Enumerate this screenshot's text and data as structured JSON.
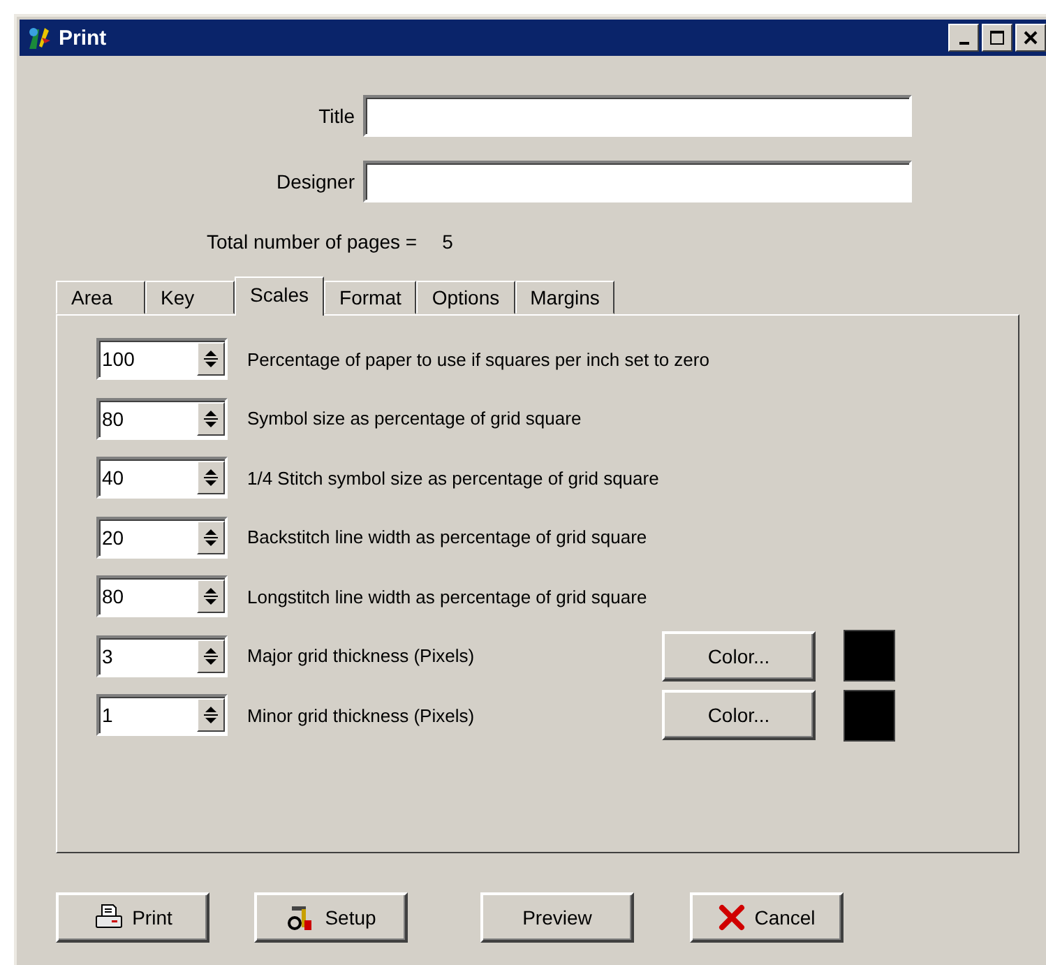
{
  "window": {
    "title": "Print"
  },
  "fields": [
    {
      "label": "Title"
    },
    {
      "label": "Designer"
    }
  ],
  "pages": {
    "label": "Total number of pages =",
    "value": "5"
  },
  "tabs": [
    {
      "label": "Area",
      "selected": false
    },
    {
      "label": "Key",
      "selected": false
    },
    {
      "label": "Scales",
      "selected": true
    },
    {
      "label": "Format",
      "selected": false
    },
    {
      "label": "Options",
      "selected": false
    },
    {
      "label": "Margins",
      "selected": false
    }
  ],
  "rows": [
    {
      "kind": "spin",
      "value": "100",
      "label": "Percentage of paper to use if squares per inch set to zero"
    },
    {
      "kind": "spin",
      "value": "80",
      "label": "Symbol size as percentage of grid square"
    },
    {
      "kind": "spin",
      "value": "40",
      "label": "1/4 Stitch symbol size as percentage of grid square"
    },
    {
      "kind": "spin",
      "value": "20",
      "label": "Backstitch line width as percentage of grid square"
    },
    {
      "kind": "spin",
      "value": "80",
      "label": "Longstitch line width as percentage of grid square"
    },
    {
      "kind": "color",
      "value": "3",
      "label": "Major grid thickness (Pixels)",
      "button": "Color...",
      "color": "#000000"
    },
    {
      "kind": "color",
      "value": "1",
      "label": "Minor grid thickness (Pixels)",
      "button": "Color...",
      "color": "#000000"
    }
  ],
  "buttons": [
    {
      "kind": "print",
      "label": "Print"
    },
    {
      "kind": "setup",
      "label": "Setup"
    },
    {
      "kind": "preview",
      "label": "Preview"
    },
    {
      "kind": "cancel",
      "label": "Cancel"
    }
  ]
}
